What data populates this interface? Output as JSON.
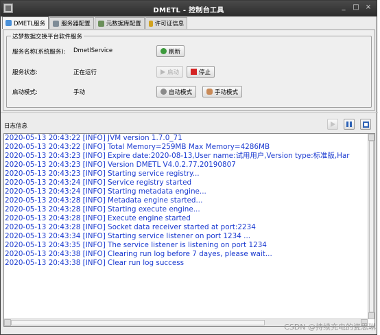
{
  "window": {
    "title": "DMETL - 控制台工具",
    "controls": {
      "minimize": "_",
      "maximize": "□",
      "close": "×"
    }
  },
  "tabs": [
    {
      "label": "DMETL服务",
      "icon": "link-icon",
      "active": true
    },
    {
      "label": "服务器配置",
      "icon": "server-icon",
      "active": false
    },
    {
      "label": "元数据库配置",
      "icon": "database-icon",
      "active": false
    },
    {
      "label": "许可证信息",
      "icon": "key-icon",
      "active": false
    }
  ],
  "service": {
    "legend": "达梦数据交换平台软件服务",
    "name_label": "服务名称(系统服务):",
    "name_value": "DmetlService",
    "refresh_label": "刷新",
    "status_label": "服务状态:",
    "status_value": "正在运行",
    "start_label": "启动",
    "stop_label": "停止",
    "startup_label": "启动模式:",
    "startup_value": "手动",
    "auto_label": "自动模式",
    "manual_label": "手动模式"
  },
  "log": {
    "title": "日志信息",
    "lines": [
      "2020-05-13 20:43:22 [INFO] JVM version 1.7.0_71",
      "2020-05-13 20:43:22 [INFO] Total Memory=259MB Max Memory=4286MB",
      "2020-05-13 20:43:23 [INFO] Expire date:2020-08-13,User name:试用用户,Version type:标准版,Har",
      "2020-05-13 20:43:23 [INFO] Version DMETL V4.0.2.77.20190807",
      "2020-05-13 20:43:23 [INFO] Starting service registry...",
      "2020-05-13 20:43:24 [INFO] Service registry started",
      "2020-05-13 20:43:24 [INFO] Starting metadata engine...",
      "2020-05-13 20:43:28 [INFO] Metadata engine started...",
      "2020-05-13 20:43:28 [INFO] Starting execute engine...",
      "2020-05-13 20:43:28 [INFO] Execute engine started",
      "2020-05-13 20:43:28 [INFO] Socket data receiver started at port:2234",
      "2020-05-13 20:43:34 [INFO] Starting service listener on port 1234 ...",
      "2020-05-13 20:43:35 [INFO] The service listener is listening on port 1234",
      "2020-05-13 20:43:38 [INFO] Clearing run log before 7 dayes, please wait...",
      "2020-05-13 20:43:38 [INFO] Clear run log success"
    ]
  },
  "watermark": "CSDN @持续充电的瓷思琳"
}
